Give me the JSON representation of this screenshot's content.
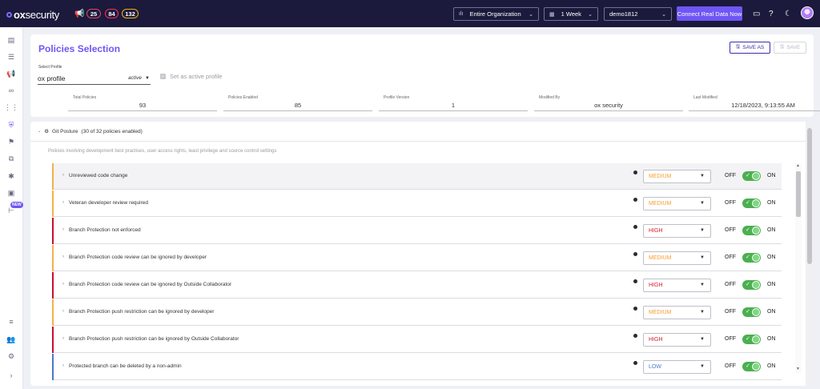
{
  "topbar": {
    "logo_ox": "ox",
    "logo_security": "security",
    "counts": [
      "25",
      "84",
      "132"
    ],
    "org_select": "Entire Organization",
    "period_select": "1 Week",
    "env_select": "demo1812",
    "connect_label": "Connect Real Data Now"
  },
  "header": {
    "title": "Policies Selection",
    "save_as_label": "SAVE AS",
    "save_label": "SAVE"
  },
  "profile": {
    "label": "Select Profile",
    "value": "ox profile",
    "status": "active",
    "set_active_label": "Set as active profile"
  },
  "meta": [
    {
      "label": "Total Policies",
      "value": "93"
    },
    {
      "label": "Policies Enabled",
      "value": "85"
    },
    {
      "label": "Profile Version",
      "value": "1"
    },
    {
      "label": "Modified By",
      "value": "ox security"
    },
    {
      "label": "Last Modified",
      "value": "12/18/2023, 9:13:55 AM"
    }
  ],
  "section": {
    "title": "Git Posture",
    "count": "(30 of 32 policies enabled)",
    "description": "Policies involving development best practises, user access rights, least privilege and source control settings"
  },
  "toggle_labels": {
    "off": "OFF",
    "on": "ON"
  },
  "sidebar": {
    "new_badge": "NEW"
  },
  "colors": {
    "medium": "#f5b04a",
    "high": "#c8102e",
    "low": "#4a78d0",
    "accent": "#6f56f5"
  },
  "policies": [
    {
      "name": "Unreviewed code change",
      "severity": "MEDIUM",
      "level": "medium",
      "enabled": true
    },
    {
      "name": "Veteran developer review required",
      "severity": "MEDIUM",
      "level": "medium",
      "enabled": true
    },
    {
      "name": "Branch Protection not enforced",
      "severity": "HIGH",
      "level": "high",
      "enabled": true
    },
    {
      "name": "Branch Protection code review can be ignored by developer",
      "severity": "MEDIUM",
      "level": "medium",
      "enabled": true
    },
    {
      "name": "Branch Protection code review can be ignored by Outside Collaborator",
      "severity": "HIGH",
      "level": "high",
      "enabled": true
    },
    {
      "name": "Branch Protection push restriction can be ignored by developer",
      "severity": "MEDIUM",
      "level": "medium",
      "enabled": true
    },
    {
      "name": "Branch Protection push restriction can be ignored by Outside Collaborator",
      "severity": "HIGH",
      "level": "high",
      "enabled": true
    },
    {
      "name": "Protected branch can be deleted by a non-admin",
      "severity": "LOW",
      "level": "low",
      "enabled": true
    }
  ]
}
